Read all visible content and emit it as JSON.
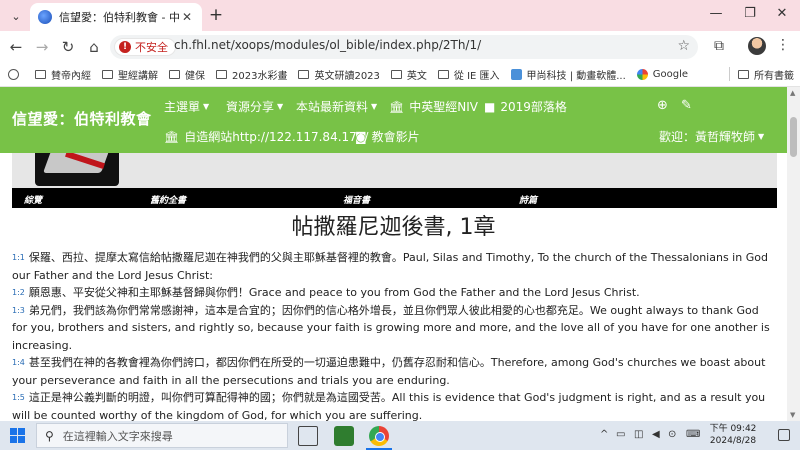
{
  "browser": {
    "tab_title": "信望愛：伯特利教會 - 中英NIV",
    "url_chip_label": "不安全",
    "url": "ch.fhl.net/xoops/modules/ol_bible/index.php/2Th/1/",
    "window_controls": {
      "minimize": "—",
      "maximize": "❐",
      "close": "✕"
    }
  },
  "bookmarks": [
    {
      "label": "賛帝內經",
      "icon": "folder"
    },
    {
      "label": "聖經講解",
      "icon": "folder"
    },
    {
      "label": "健保",
      "icon": "folder"
    },
    {
      "label": "2023水彩畫",
      "icon": "folder"
    },
    {
      "label": "英文研讀2023",
      "icon": "folder"
    },
    {
      "label": "英文",
      "icon": "folder"
    },
    {
      "label": "從 IE 匯入",
      "icon": "folder"
    },
    {
      "label": "甲尚科技 | 動畫軟體...",
      "icon": "app"
    },
    {
      "label": "Google",
      "icon": "google"
    }
  ],
  "bookmarks_all": "所有書籤",
  "site": {
    "name": "信望愛：伯特利教會",
    "nav": {
      "menu": "主選單",
      "resources": "資源分享",
      "latest": "本站最新資料",
      "niv": "中英聖經NIV",
      "blog": "2019部落格",
      "selfsite": "自造網站http://122.117.84.174/",
      "video": "教會影片",
      "welcome": "歡迎：黃哲輝牧師"
    }
  },
  "bible_nav": [
    "綜覽",
    "舊約全書",
    "福音書",
    "詩篇"
  ],
  "chapter_title": "帖撒羅尼迦後書, 1章",
  "verses": [
    {
      "num": "1:1",
      "text": "保羅、西拉、提摩太寫信給帖撒羅尼迦在神我們的父與主耶穌基督裡的教會。Paul, Silas and Timothy, To the church of the Thessalonians in God our Father and the Lord Jesus Christ:"
    },
    {
      "num": "1:2",
      "text": "願恩惠、平安從父神和主耶穌基督歸與你們！Grace and peace to you from God the Father and the Lord Jesus Christ."
    },
    {
      "num": "1:3",
      "text": "弟兄們，我們該為你們常常感謝神，這本是合宜的；因你們的信心格外增長，並且你們眾人彼此相愛的心也都充足。We ought always to thank God for you, brothers and sisters, and rightly so, because your faith is growing more and more, and the love all of you have for one another is increasing."
    },
    {
      "num": "1:4",
      "text": "甚至我們在神的各教會裡為你們誇口，都因你們在所受的一切逼迫患難中，仍舊存忍耐和信心。Therefore, among God's churches we boast about your perseverance and faith in all the persecutions and trials you are enduring."
    },
    {
      "num": "1:5",
      "text": "這正是神公義判斷的明證，叫你們可算配得神的國；你們就是為這國受苦。All this is evidence that God's judgment is right, and as a result you will be counted worthy of the kingdom of God, for which you are suffering."
    }
  ],
  "taskbar": {
    "search_placeholder": "在這裡輸入文字來搜尋",
    "tray_text": "^",
    "time": "下午 09:42",
    "date": "2024/8/28"
  }
}
